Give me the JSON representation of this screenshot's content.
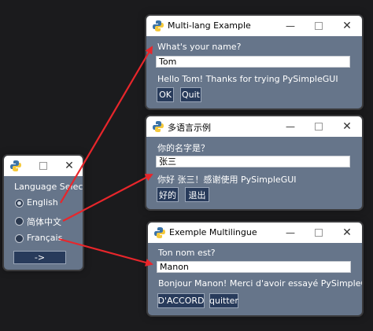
{
  "launcher": {
    "language_label": "Language Selec",
    "options": [
      "English",
      "简体中文",
      "Français"
    ],
    "selected_index": 0,
    "go_button": "->"
  },
  "windows": [
    {
      "title": "Multi-lang Example",
      "prompt": "What's your name?",
      "input_value": "Tom",
      "greeting": "Hello Tom! Thanks for trying PySimpleGUI",
      "ok_label": "OK",
      "quit_label": "Quit"
    },
    {
      "title": "多语言示例",
      "prompt": "你的名字是？",
      "input_value": "张三",
      "greeting": "你好 张三！感谢使用 PySimpleGUI",
      "ok_label": "好的",
      "quit_label": "退出"
    },
    {
      "title": "Exemple Multilingue",
      "prompt": "Ton nom est?",
      "input_value": "Manon",
      "greeting": "Bonjour Manon! Merci d'avoir essayé PySimpleGUI",
      "ok_label": "D'ACCORD",
      "quit_label": "quitter"
    }
  ],
  "colors": {
    "window_bg": "#66758a",
    "button_bg": "#283b5b",
    "arrow": "#e8262b",
    "desktop": "#1b1b1d"
  },
  "icons": {
    "app": "python-logo-icon",
    "minimize": "minimize-icon",
    "maximize": "maximize-icon",
    "close": "close-icon"
  }
}
